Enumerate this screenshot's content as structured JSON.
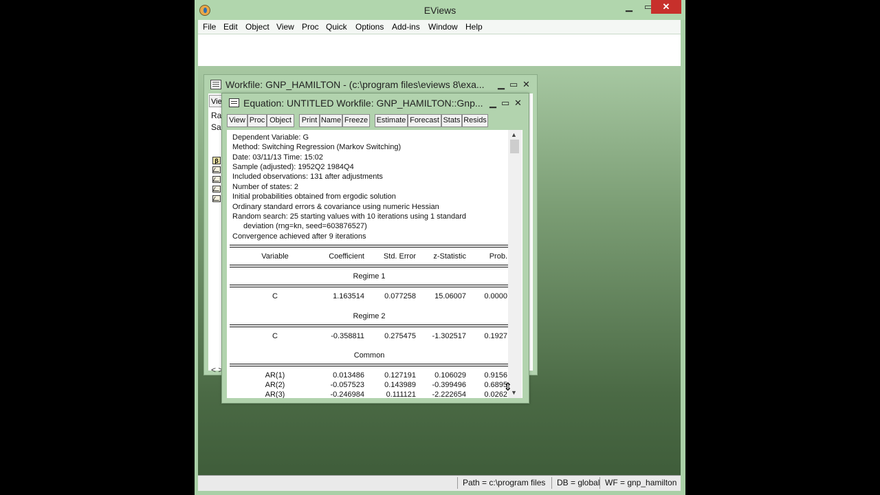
{
  "app": {
    "title": "EViews",
    "minimize": "▁",
    "maximize": "▭",
    "close": "✕",
    "menu": [
      "File",
      "Edit",
      "Object",
      "View",
      "Proc",
      "Quick",
      "Options",
      "Add-ins",
      "Window",
      "Help"
    ]
  },
  "status_bar": {
    "path": "Path = c:\\program files",
    "db": "DB = global",
    "wf": "WF = gnp_hamilton"
  },
  "workfile": {
    "title": "Workfile: GNP_HAMILTON - (c:\\program files\\eviews 8\\exa...",
    "view_btn": "View",
    "range_label": "Ra",
    "sample_label": "Sa",
    "scroll_arrows": "< >"
  },
  "equation": {
    "title": "Equation: UNTITLED   Workfile: GNP_HAMILTON::Gnp...",
    "toolbar": [
      "View",
      "Proc",
      "Object",
      "Print",
      "Name",
      "Freeze",
      "Estimate",
      "Forecast",
      "Stats",
      "Resids"
    ],
    "header_lines": [
      "Dependent Variable: G",
      "Method: Switching Regression (Markov Switching)",
      "Date: 03/11/13   Time: 15:02",
      "Sample (adjusted): 1952Q2 1984Q4",
      "Included observations: 131 after adjustments",
      "Number of states: 2",
      "Initial probabilities obtained from ergodic solution",
      "Ordinary standard errors & covariance using numeric Hessian",
      "Random search: 25 starting values with 10 iterations using 1 standard",
      "      deviation (rng=kn, seed=603876527)",
      "Convergence achieved after 9 iterations"
    ],
    "columns": [
      "Variable",
      "Coefficient",
      "Std. Error",
      "z-Statistic",
      "Prob."
    ],
    "regime1_label": "Regime 1",
    "regime1_row": [
      "C",
      "1.163514",
      "0.077258",
      "15.06007",
      "0.0000"
    ],
    "regime2_label": "Regime 2",
    "regime2_row": [
      "C",
      "-0.358811",
      "0.275475",
      "-1.302517",
      "0.1927"
    ],
    "common_label": "Common",
    "common_rows": [
      [
        "AR(1)",
        "0.013486",
        "0.127191",
        "0.106029",
        "0.9156"
      ],
      [
        "AR(2)",
        "-0.057523",
        "0.143989",
        "-0.399496",
        "0.6895"
      ],
      [
        "AR(3)",
        "-0.246984",
        "0.111121",
        "-2.222654",
        "0.0262"
      ]
    ]
  }
}
